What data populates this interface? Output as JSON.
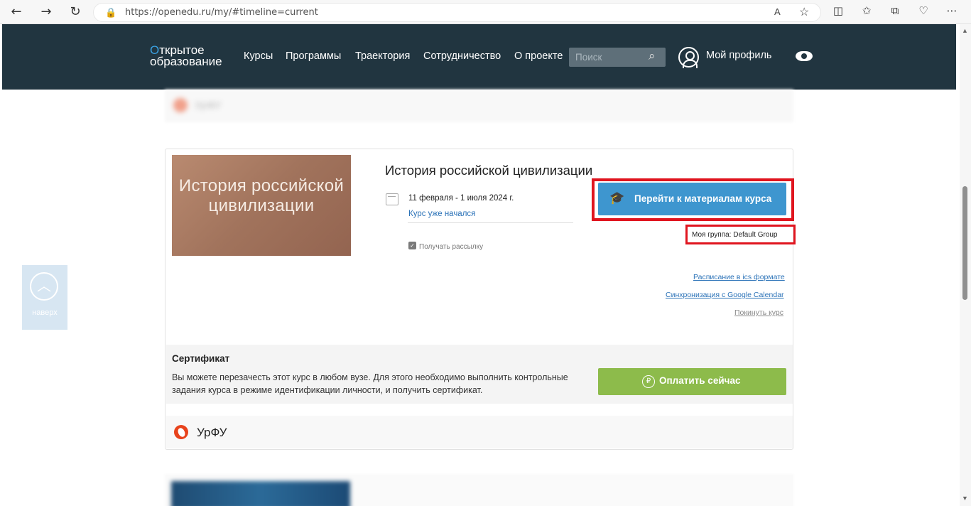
{
  "browser": {
    "url": "https://openedu.ru/my/#timeline=current",
    "back_icon": "←",
    "forward_icon": "→",
    "refresh_icon": "↻",
    "reader_icon": "A",
    "favorite_icon": "☆",
    "toolbar_icons": [
      "split-screen-icon",
      "favorites-icon",
      "collections-icon",
      "extensions-icon",
      "more-icon"
    ]
  },
  "site": {
    "logo_line1": "ткрытое",
    "logo_o": "О",
    "logo_line2": "образование",
    "menu": [
      "Курсы",
      "Программы",
      "Траектория",
      "Сотрудничество",
      "О проекте"
    ],
    "search_placeholder": "Поиск",
    "profile_label": "Мой профиль"
  },
  "course": {
    "image_text": "История российской цивилизации",
    "title": "История российской цивилизации",
    "dates": "11 февраля - 1 июля 2024 г.",
    "status": "Курс уже начался",
    "newsletter_label": "Получать рассылку",
    "newsletter_checked": true,
    "go_button": "Перейти к материалам курса",
    "group": "Моя группа: Default Group",
    "links": [
      "Расписание в ics формате",
      "Синхронизация с Google Calendar",
      "Покинуть курс"
    ]
  },
  "certificate": {
    "title": "Сертификат",
    "text": "Вы можете перезачесть этот курс в любом вузе. Для этого необходимо выполнить контрольные задания курса в режиме идентификации личности, и получить сертификат.",
    "pay_button": "Оплатить сейчас",
    "pay_icon": "₽"
  },
  "university": {
    "name": "УрФУ"
  },
  "back_to_top": {
    "label": "наверх"
  },
  "colors": {
    "header_bg": "#213540",
    "primary_button": "#3e96cf",
    "pay_button": "#8dbb4b",
    "highlight": "#e0151f",
    "link": "#2c73b8"
  }
}
